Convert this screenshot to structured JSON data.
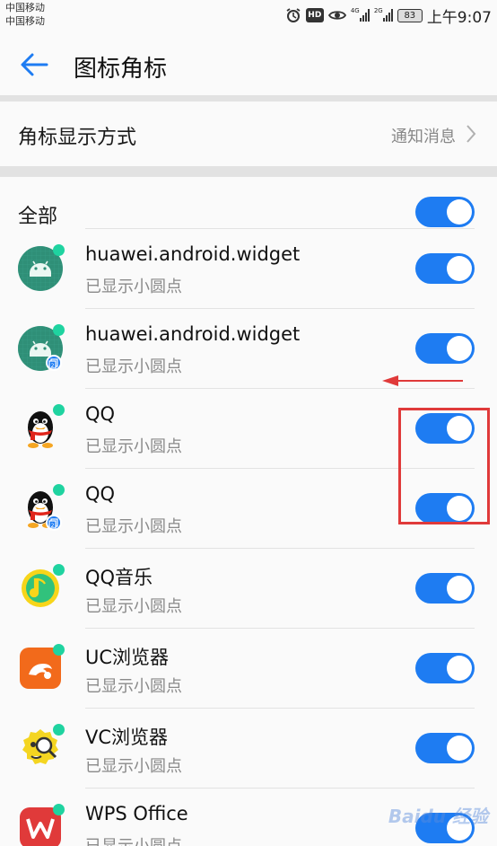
{
  "status_bar": {
    "carrier1": "中国移动",
    "carrier2": "中国移动",
    "hd": "HD",
    "net1": "4G",
    "net2": "2G",
    "battery": "83",
    "time": "上午9:07"
  },
  "header": {
    "title": "图标角标",
    "back_icon": "arrow-left-icon"
  },
  "badge_mode": {
    "label": "角标显示方式",
    "value": "通知消息"
  },
  "all": {
    "label": "全部",
    "enabled": true
  },
  "apps": [
    {
      "name": "huawei.android.widget",
      "status": "已显示小圆点",
      "icon": "android-icon",
      "clone": false,
      "enabled": true
    },
    {
      "name": "huawei.android.widget",
      "status": "已显示小圆点",
      "icon": "android-icon",
      "clone": true,
      "clone_label": "2",
      "enabled": true
    },
    {
      "name": "QQ",
      "status": "已显示小圆点",
      "icon": "qq-penguin-icon",
      "clone": false,
      "enabled": true
    },
    {
      "name": "QQ",
      "status": "已显示小圆点",
      "icon": "qq-penguin-icon",
      "clone": true,
      "clone_label": "2",
      "enabled": true
    },
    {
      "name": "QQ音乐",
      "status": "已显示小圆点",
      "icon": "qq-music-icon",
      "clone": false,
      "enabled": true
    },
    {
      "name": "UC浏览器",
      "status": "已显示小圆点",
      "icon": "uc-browser-icon",
      "clone": false,
      "enabled": true
    },
    {
      "name": "VC浏览器",
      "status": "已显示小圆点",
      "icon": "vc-browser-icon",
      "clone": false,
      "enabled": true
    },
    {
      "name": "WPS Office",
      "status": "已显示小圆点",
      "icon": "wps-office-icon",
      "clone": false,
      "enabled": true
    }
  ],
  "watermark": "Baidu 经验",
  "colors": {
    "accent": "#1e7cf2",
    "badge_dot": "#1fd3a0",
    "annotation": "#e03a3a"
  }
}
